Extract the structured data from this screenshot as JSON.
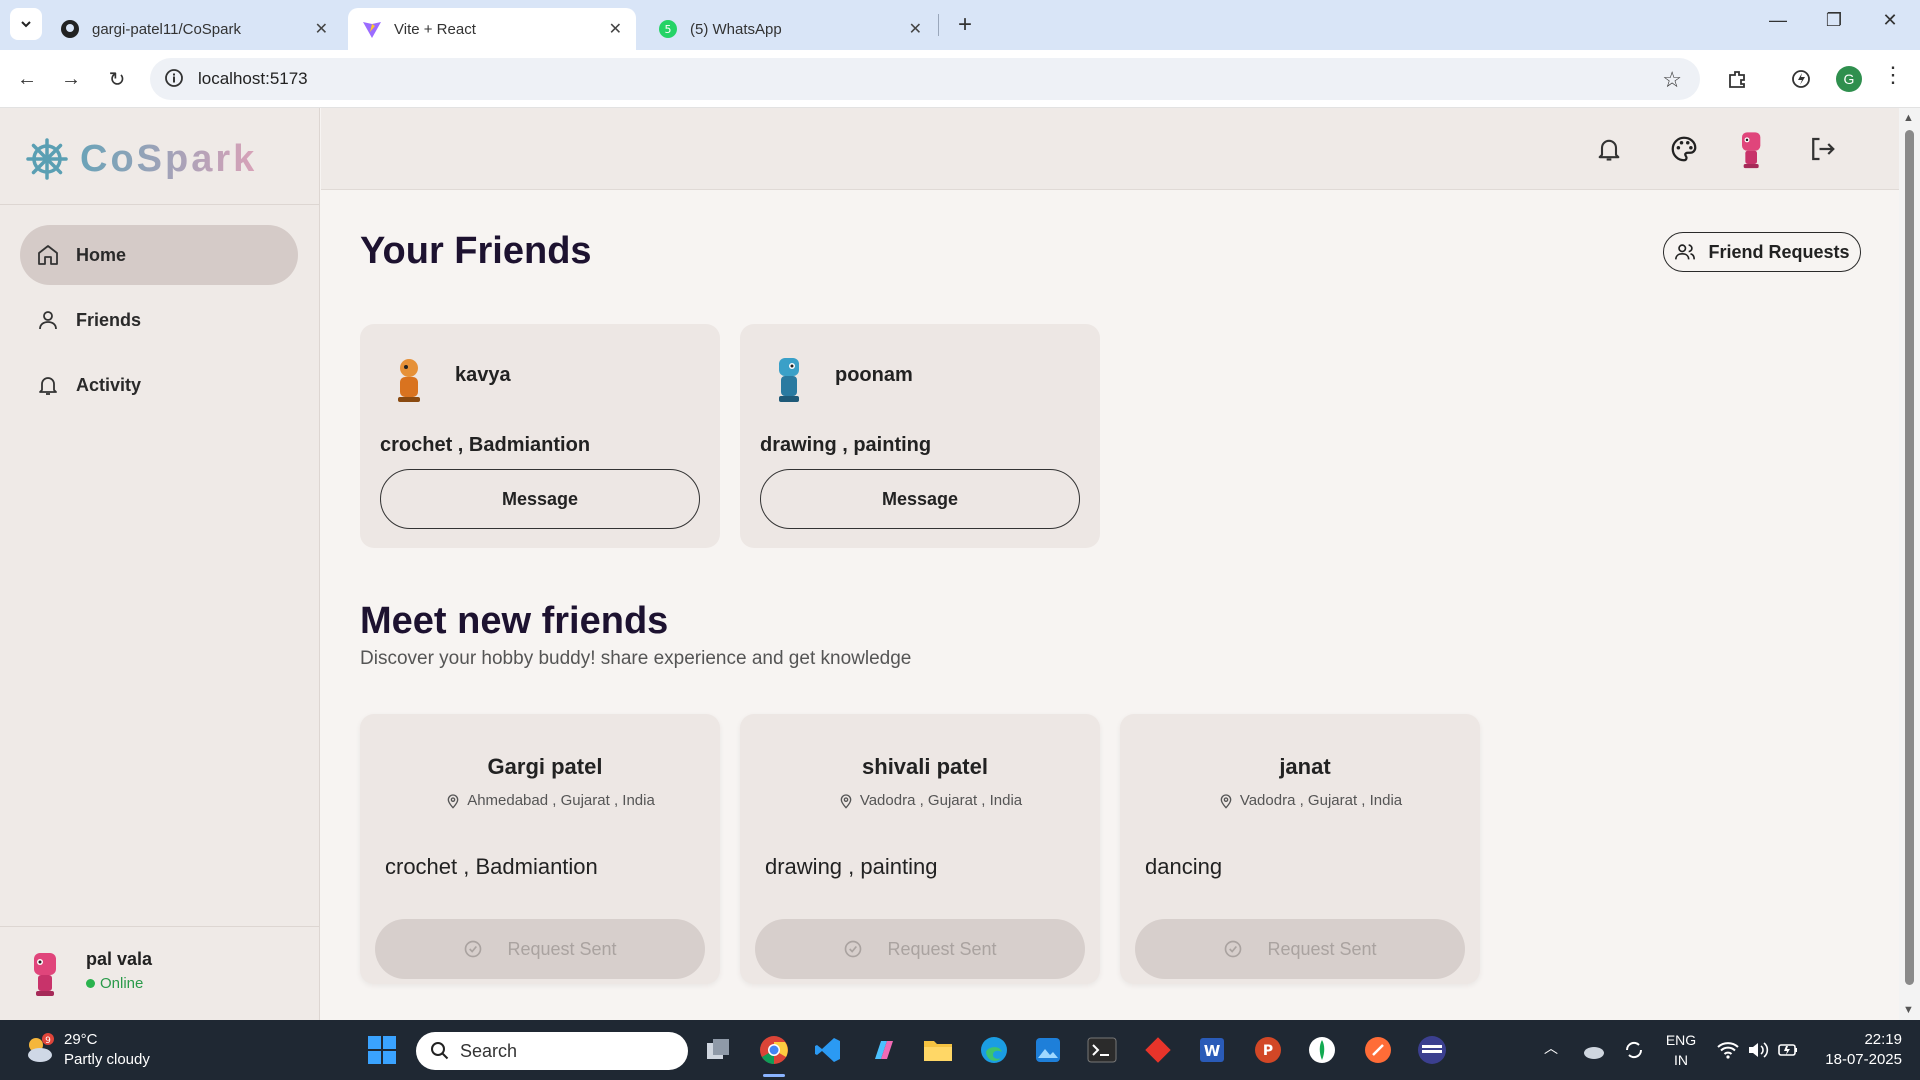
{
  "browser": {
    "tabs": [
      {
        "label": "gargi-patel11/CoSpark",
        "icon": "github-icon"
      },
      {
        "label": "Vite + React",
        "icon": "vite-icon"
      },
      {
        "label": "(5) WhatsApp",
        "icon": "whatsapp-icon",
        "badge": "5"
      }
    ],
    "url": "localhost:5173",
    "profile_initial": "G"
  },
  "app": {
    "brand": "CoSpark",
    "nav": [
      {
        "label": "Home",
        "icon": "home-icon",
        "active": true
      },
      {
        "label": "Friends",
        "icon": "user-icon"
      },
      {
        "label": "Activity",
        "icon": "bell-icon"
      }
    ],
    "current_user": {
      "name": "pal vala",
      "status": "Online"
    },
    "friend_requests_label": "Friend Requests",
    "your_friends_title": "Your Friends",
    "friends": [
      {
        "name": "kavya",
        "hobbies": "crochet , Badmiantion",
        "action": "Message"
      },
      {
        "name": "poonam",
        "hobbies": "drawing , painting",
        "action": "Message"
      }
    ],
    "meet_title": "Meet new friends",
    "meet_subtitle": "Discover your hobby buddy! share experience and get knowledge",
    "suggestions": [
      {
        "name": "Gargi patel",
        "location": "Ahmedabad , Gujarat , India",
        "hobbies": "crochet , Badmiantion",
        "action": "Request Sent"
      },
      {
        "name": "shivali patel",
        "location": "Vadodra , Gujarat , India",
        "hobbies": "drawing , painting",
        "action": "Request Sent"
      },
      {
        "name": "janat",
        "location": "Vadodra , Gujarat , India",
        "hobbies": "dancing",
        "action": "Request Sent"
      }
    ]
  },
  "taskbar": {
    "weather_temp": "29°C",
    "weather_desc": "Partly cloudy",
    "weather_badge": "9",
    "search_label": "Search",
    "lang_1": "ENG",
    "lang_2": "IN",
    "time": "22:19",
    "date": "18-07-2025"
  },
  "colors": {
    "accent": "#2ab34e",
    "brand_start": "#6aa3b8",
    "brand_end": "#d9a2b8"
  }
}
